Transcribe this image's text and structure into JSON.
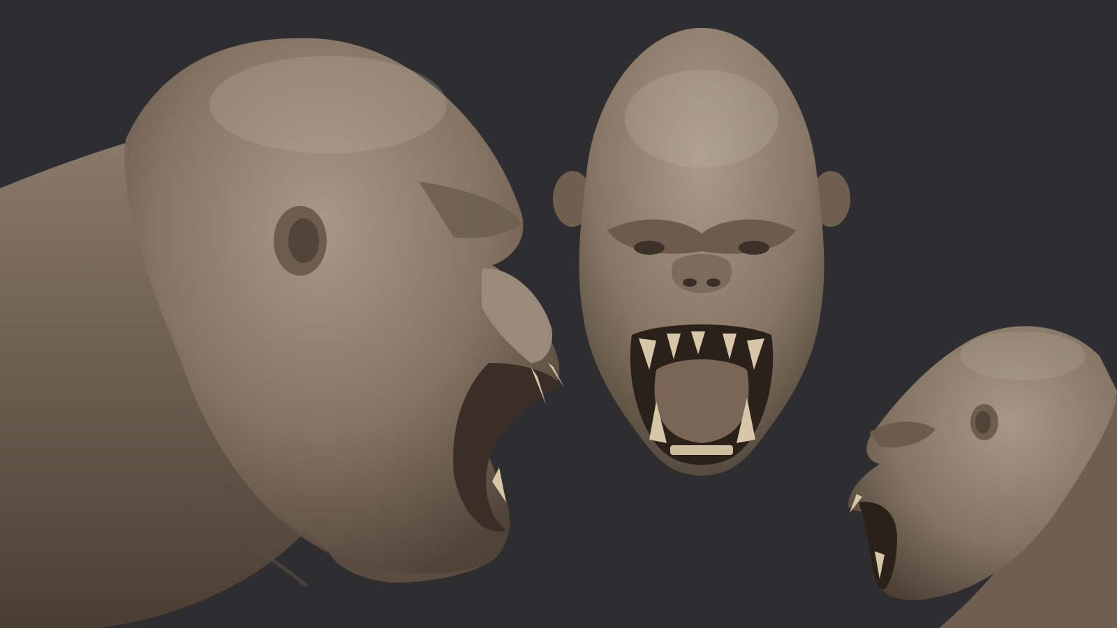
{
  "scene": {
    "background_color": "#2e2e30",
    "clay_color": "#8a7a6a",
    "clay_highlight": "#b3a696",
    "clay_shadow": "#4a3f35",
    "tooth_color": "#d8c6a8",
    "mouth_color": "#2a211b"
  },
  "views": [
    {
      "name": "side-view-left",
      "description_icon": "gorilla-head-profile-right-facing"
    },
    {
      "name": "front-view",
      "description_icon": "gorilla-head-front"
    },
    {
      "name": "side-view-right",
      "description_icon": "gorilla-head-profile-left-facing"
    }
  ]
}
